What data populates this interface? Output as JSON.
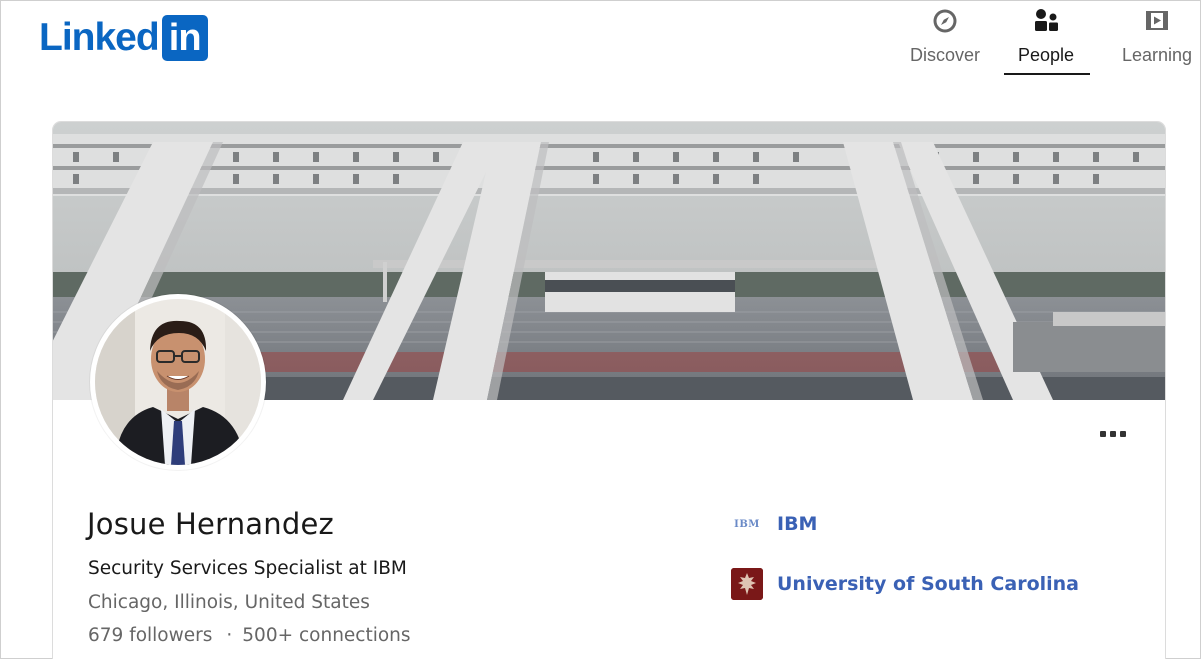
{
  "header": {
    "logo_text": "Linked",
    "logo_box_text": "in",
    "brand_color": "#0a66c2"
  },
  "nav": {
    "items": [
      {
        "label": "Discover",
        "icon": "compass-icon",
        "active": false
      },
      {
        "label": "People",
        "icon": "people-icon",
        "active": true
      },
      {
        "label": "Learning",
        "icon": "play-icon",
        "active": false
      }
    ]
  },
  "profile": {
    "name": "Josue Hernandez",
    "headline": "Security Services Specialist at IBM",
    "location": "Chicago, Illinois, United States",
    "followers": "679 followers",
    "separator": "·",
    "connections": "500+ connections",
    "more_icon": "more-horizontal-icon",
    "banner": "stadium-banner",
    "avatar": "profile-photo"
  },
  "organizations": [
    {
      "name": "IBM",
      "logo_text": "IBM",
      "logo_color": "#6a8ac7"
    },
    {
      "name": "University of South Carolina",
      "logo_color": "#7a1818"
    }
  ],
  "colors": {
    "link": "#3a61b5",
    "secondary_text": "#666666",
    "primary_text": "#191919"
  }
}
